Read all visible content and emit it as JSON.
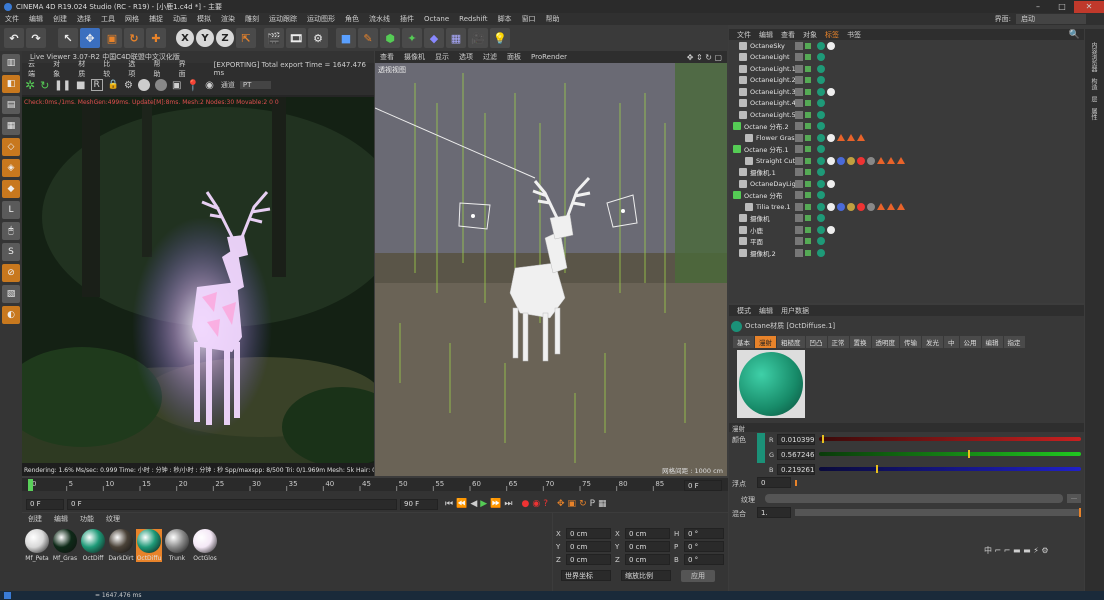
{
  "window": {
    "title": "CINEMA 4D R19.024 Studio (RC - R19) - [小鹿1.c4d *] - 主要"
  },
  "menubar": [
    "文件",
    "编辑",
    "创建",
    "选择",
    "工具",
    "网格",
    "捕捉",
    "动画",
    "模拟",
    "渲染",
    "雕刻",
    "运动跟踪",
    "运动图形",
    "角色",
    "流水线",
    "插件",
    "Octane",
    "Redshift",
    "脚本",
    "窗口",
    "帮助"
  ],
  "interface": {
    "label": "界面:",
    "value": "启动"
  },
  "toolbar": {
    "axes": [
      "X",
      "Y",
      "Z"
    ]
  },
  "live_viewer": {
    "title": "Live Viewer 3.07-R2 中国C4D联盟中文汉化版",
    "menu": [
      "云端",
      "对象",
      "材质",
      "比较",
      "选项",
      "帮助",
      "界面"
    ],
    "export_status": "[EXPORTING] Total export Time = 1647.476 ms",
    "channel_label": "通道",
    "channel_value": "PT",
    "info": "Check:0ms./1ms. MeshGen:499ms. Update[M]:8ms. Mesh:2 Nodes:30 Movable:2  0 0",
    "status": "Rendering: 1.6%    Ms/sec: 0.999    Time: 小时 : 分钟 : 秒/小时 : 分钟 : 秒    Spp/maxspp: 8/500    Tri: 0/1.969m   Mesh: 5k   Hair: 0"
  },
  "viewport": {
    "menu": [
      "查看",
      "摄像机",
      "显示",
      "选项",
      "过滤",
      "面板",
      "ProRender"
    ],
    "label": "透视视图",
    "grid": "网格间距 : 1000 cm"
  },
  "timeline": {
    "ticks": [
      "0",
      "5",
      "10",
      "15",
      "20",
      "25",
      "30",
      "35",
      "40",
      "45",
      "50",
      "55",
      "60",
      "65",
      "70",
      "75",
      "80",
      "85",
      "90"
    ],
    "current": "0 F",
    "start": "0 F",
    "f1": "0 F",
    "end1": "90 F",
    "end2": "90 F"
  },
  "materials": {
    "menu": [
      "创建",
      "编辑",
      "功能",
      "纹理"
    ],
    "items": [
      {
        "name": "Mf_Peta",
        "color": "#d8d8d8"
      },
      {
        "name": "Mf_Gras",
        "color": "#0e2a18"
      },
      {
        "name": "OctDiff",
        "color": "#1e9a78"
      },
      {
        "name": "DarkDirt",
        "color": "#4a4238"
      },
      {
        "name": "OctDiffu",
        "color": "#1e9a78"
      },
      {
        "name": "Trunk",
        "color": "#8a8a8a"
      },
      {
        "name": "OctGlos",
        "color": "#f4e8f6"
      }
    ]
  },
  "coordinates": {
    "rows": [
      {
        "a": "X",
        "av": "0 cm",
        "b": "X",
        "bv": "0 cm",
        "c": "H",
        "cv": "0 °"
      },
      {
        "a": "Y",
        "av": "0 cm",
        "b": "Y",
        "bv": "0 cm",
        "c": "P",
        "cv": "0 °"
      },
      {
        "a": "Z",
        "av": "0 cm",
        "b": "Z",
        "bv": "0 cm",
        "c": "B",
        "cv": "0 °"
      }
    ],
    "mode1": "世界坐标",
    "mode2": "缩放比例",
    "apply": "应用"
  },
  "object_manager": {
    "menu": [
      "文件",
      "编辑",
      "查看",
      "对象",
      "标签",
      "书签"
    ],
    "objects": [
      {
        "name": "OctaneSky",
        "indent": 1
      },
      {
        "name": "OctaneLight",
        "indent": 1
      },
      {
        "name": "OctaneLight.1",
        "indent": 1
      },
      {
        "name": "OctaneLight.2",
        "indent": 1
      },
      {
        "name": "OctaneLight.3",
        "indent": 1
      },
      {
        "name": "OctaneLight.4",
        "indent": 1
      },
      {
        "name": "OctaneLight.5",
        "indent": 1
      },
      {
        "name": "Octane 分布.2",
        "indent": 0
      },
      {
        "name": "Flower Grass",
        "indent": 2
      },
      {
        "name": "Octane 分布.1",
        "indent": 0
      },
      {
        "name": "Straight Cut (",
        "indent": 2
      },
      {
        "name": "摄像机.1",
        "indent": 1
      },
      {
        "name": "OctaneDayLigh",
        "indent": 1
      },
      {
        "name": "Octane 分布",
        "indent": 0
      },
      {
        "name": "Tilia tree.1",
        "indent": 2
      },
      {
        "name": "摄像机",
        "indent": 1
      },
      {
        "name": "小鹿",
        "indent": 1
      },
      {
        "name": "平面",
        "indent": 1
      },
      {
        "name": "摄像机.2",
        "indent": 1
      }
    ]
  },
  "attributes": {
    "menu": [
      "模式",
      "编辑",
      "用户数据"
    ],
    "material_name": "Octane材质 [OctDiffuse.1]",
    "tabs": [
      "基本",
      "漫射",
      "粗糙度",
      "凹凸",
      "正常",
      "置换",
      "透明度",
      "传输",
      "发光",
      "中",
      "公用",
      "编辑",
      "指定"
    ],
    "active_tab": "漫射",
    "section": "漫射",
    "color_label": "颜色",
    "r": "0.010399",
    "g": "0.567246",
    "b": "0.219261",
    "r_frac": 0.01,
    "g_frac": 0.567,
    "b_frac": 0.219,
    "float_label": "浮点",
    "float_value": "0",
    "texture_label": "纹理",
    "mix_label": "混合",
    "mix_value": "1."
  },
  "right_tabs": [
    "内容浏览器",
    "构造",
    "层",
    "属性"
  ],
  "taskbar": {
    "time": "= 1647.476 ms"
  },
  "colors": {
    "accent": "#e8832a",
    "swatch": "#1b9178"
  }
}
